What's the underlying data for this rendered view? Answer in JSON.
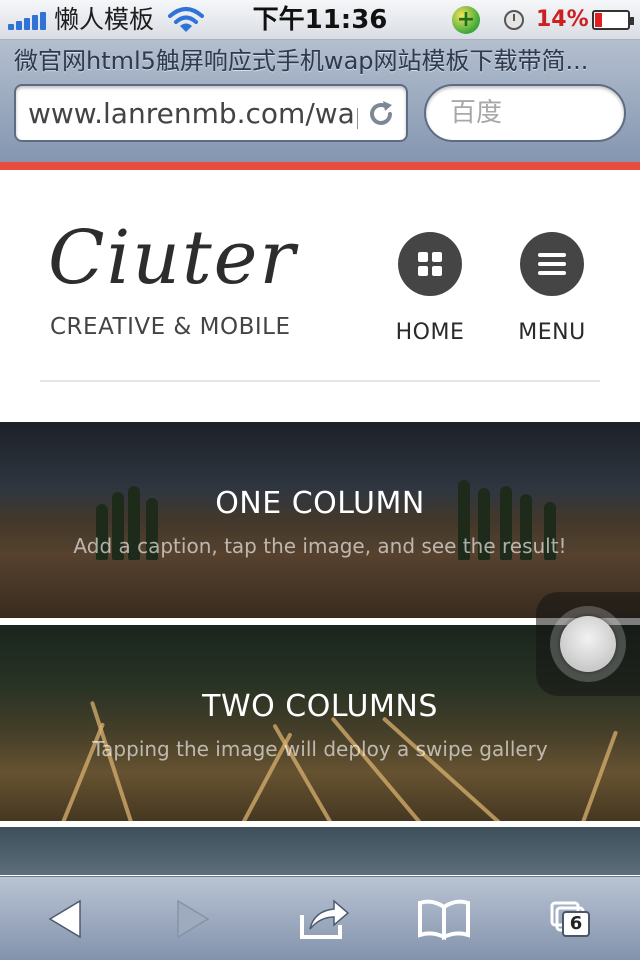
{
  "status_bar": {
    "carrier": "懒人模板",
    "time": "下午11:36",
    "battery_percent": "14%",
    "battery_level": 0.14,
    "signal_bars": 5,
    "accent_battery_color": "#cc2020"
  },
  "browser": {
    "page_title": "微官网html5触屏响应式手机wap网站模板下载带简...",
    "url": "www.lanrenmb.com/wap",
    "search_placeholder": "百度",
    "stripe_color": "#e74c3c",
    "tabs_count": "6"
  },
  "site": {
    "logo": "Ciuter",
    "tagline": "CREATIVE & MOBILE",
    "nav": {
      "home_label": "HOME",
      "menu_label": "MENU"
    }
  },
  "banners": [
    {
      "title": "ONE COLUMN",
      "caption": "Add a caption, tap the image, and see the result!"
    },
    {
      "title": "TWO COLUMNS",
      "caption": "Tapping the image will deploy a swipe gallery"
    }
  ],
  "icons": {
    "wifi": "wifi-icon",
    "reload": "reload-icon",
    "home": "grid-icon",
    "menu": "hamburger-icon",
    "back": "back-arrow-icon",
    "forward": "forward-arrow-icon",
    "share": "share-icon",
    "bookmarks": "bookmarks-icon",
    "tabs": "tabs-icon"
  }
}
